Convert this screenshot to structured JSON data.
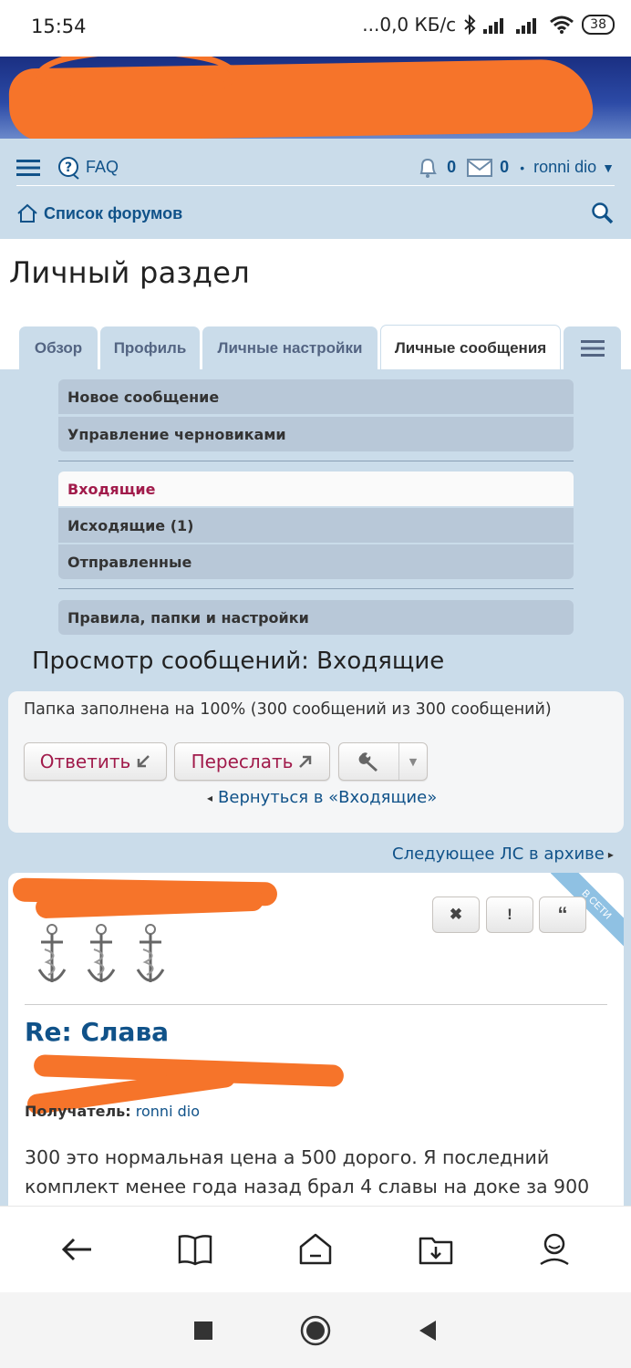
{
  "status_bar": {
    "time": "15:54",
    "network": "...0,0 КБ/с",
    "battery": "38"
  },
  "forum_nav": {
    "faq": "FAQ",
    "notifications_count": "0",
    "messages_count": "0",
    "separator": "•",
    "username": "ronni dio",
    "forum_index": "Список форумов"
  },
  "page_title": "Личный раздел",
  "tabs": [
    {
      "label": "Обзор"
    },
    {
      "label": "Профиль"
    },
    {
      "label": "Личные настройки"
    },
    {
      "label": "Личные сообщения"
    }
  ],
  "pm_menu": {
    "new_message": "Новое сообщение",
    "drafts": "Управление черновиками",
    "inbox": "Входящие",
    "outbox": "Исходящие (1)",
    "sent": "Отправленные",
    "rules": "Правила, папки и настройки"
  },
  "view_title": "Просмотр сообщений: Входящие",
  "folder_status": "Папка заполнена на 100% (300 сообщений из 300 сообщений)",
  "actions": {
    "reply": "Ответить",
    "forward": "Переслать"
  },
  "return_link": "Вернуться в «Входящие»",
  "next_link": "Следующее ЛС в архиве",
  "post": {
    "online_badge": "В СЕТИ",
    "title": "Re: Слава",
    "recipient_label": "Получатель:",
    "recipient": "ronni dio",
    "body": "300 это нормальная цена а 500 дорого. Я последний комплект менее года назад брал 4 славы на доке за 900"
  },
  "colors": {
    "accent": "#105289",
    "active_link": "#a11b4b",
    "panel_bg": "#cadcea",
    "redaction": "#f6742a"
  }
}
